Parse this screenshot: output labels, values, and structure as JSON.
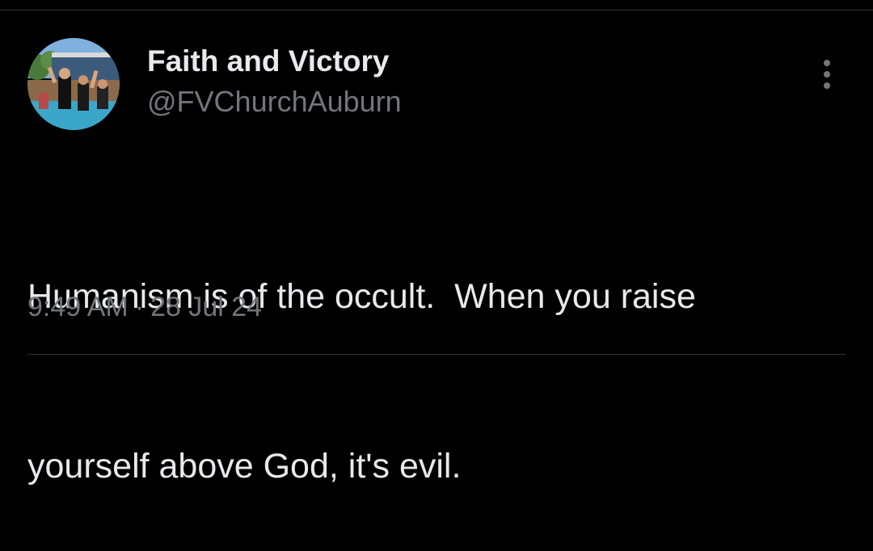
{
  "tweet": {
    "author": {
      "display_name": "Faith and Victory",
      "handle": "@FVChurchAuburn",
      "avatar_icon": "profile-photo-baptism-pool"
    },
    "text_line_1": "Humanism is of the occult.  When you raise",
    "text_line_2": "yourself above God, it's evil.",
    "time": "9:49 AM",
    "separator": "·",
    "date": "28 Jul 24",
    "more_icon": "vertical-ellipsis-icon"
  },
  "colors": {
    "background": "#000000",
    "text_primary": "#e7e9ea",
    "text_secondary": "#71767b",
    "divider": "#2f3336"
  }
}
